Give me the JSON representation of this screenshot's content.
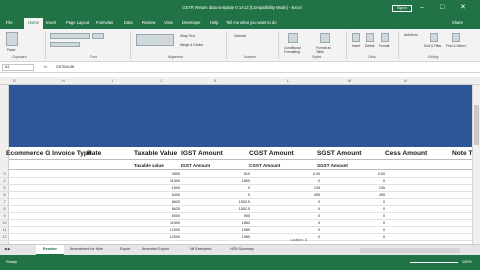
{
  "title_bar": {
    "title": "GSTR Return data template 0 1A13 [Compatibility Mode] - Excel",
    "sign_in": "Sign in",
    "minimize": "–",
    "restore": "□",
    "close": "✕"
  },
  "ribbon_tabs": [
    "File",
    "Home",
    "Insert",
    "Page Layout",
    "Formulas",
    "Data",
    "Review",
    "View",
    "Developer",
    "Help"
  ],
  "tell_me": "Tell me what you want to do",
  "share": "Share",
  "ribbon_groups": [
    "Clipboard",
    "Font",
    "Alignment",
    "Number",
    "Styles",
    "Cells",
    "Editing"
  ],
  "ribbon_buttons": {
    "paste": "Paste",
    "wrap_text": "Wrap Text",
    "merge_center": "Merge & Center",
    "general": "General",
    "conditional_formatting": "Conditional Formatting",
    "format_as_table": "Format as Table",
    "insert": "Insert",
    "delete": "Delete",
    "format": "Format",
    "autosum": "AutoSum",
    "sort_filter": "Sort & Filter",
    "find_select": "Find & Select"
  },
  "formula_bar": {
    "name_box": "A1",
    "fx": "fx",
    "value": "GSTIN/UIN"
  },
  "column_headers": [
    "G",
    "H",
    "I",
    "J",
    "K",
    "L",
    "M",
    "N"
  ],
  "header_row": {
    "row_number": "1",
    "e_commerce_gstin": "Ecommerce G Invoice Type",
    "rate": "Rate",
    "taxable_value": "Taxable Value",
    "igst_amount": "IGST Amount",
    "cgst_amount": "CGST Amount",
    "sgst_amount": "SGST Amount",
    "cess_amount": "Cess Amount",
    "note": "Note T"
  },
  "subheader_row": {
    "row_number": "2",
    "taxable_value": "Taxable value",
    "igst_amount": "IGST Amount",
    "cgst_amount": "CGST Amount",
    "sgst_amount": "SGST Amount"
  },
  "rows": [
    {
      "n": "3",
      "taxable": "4500",
      "igst": "810",
      "cgst": "0.00",
      "sgst": "0.00"
    },
    {
      "n": "4",
      "taxable": "11500",
      "igst": "1800",
      "cgst": "0",
      "sgst": "0"
    },
    {
      "n": "5",
      "taxable": "1500",
      "igst": "0",
      "cgst": "135",
      "sgst": "135"
    },
    {
      "n": "6",
      "taxable": "5400",
      "igst": "0",
      "cgst": "495",
      "sgst": "495"
    },
    {
      "n": "7",
      "taxable": "8625",
      "igst": "1552.5",
      "cgst": "0",
      "sgst": "0"
    },
    {
      "n": "8",
      "taxable": "8625",
      "igst": "1552.5",
      "cgst": "0",
      "sgst": "0"
    },
    {
      "n": "9",
      "taxable": "5000",
      "igst": "900",
      "cgst": "0",
      "sgst": "0"
    },
    {
      "n": "10",
      "taxable": "11500",
      "igst": "1863",
      "cgst": "0",
      "sgst": "0"
    },
    {
      "n": "11",
      "taxable": "12000",
      "igst": "1980",
      "cgst": "0",
      "sgst": "0"
    },
    {
      "n": "12",
      "taxable": "12000",
      "igst": "1980",
      "cgst": "0",
      "sgst": "0"
    }
  ],
  "status_hint": "Location: D",
  "sheet_tabs": [
    "Readme",
    "Amendment for Note",
    "Export",
    "Amended Export",
    "Nil Exempted",
    "HSN Summary"
  ],
  "active_sheet": "Readme",
  "status_bar": {
    "ready": "Ready",
    "zoom": "100%"
  },
  "colors": {
    "excel_green": "#217346",
    "banner_blue": "#2e5597"
  }
}
